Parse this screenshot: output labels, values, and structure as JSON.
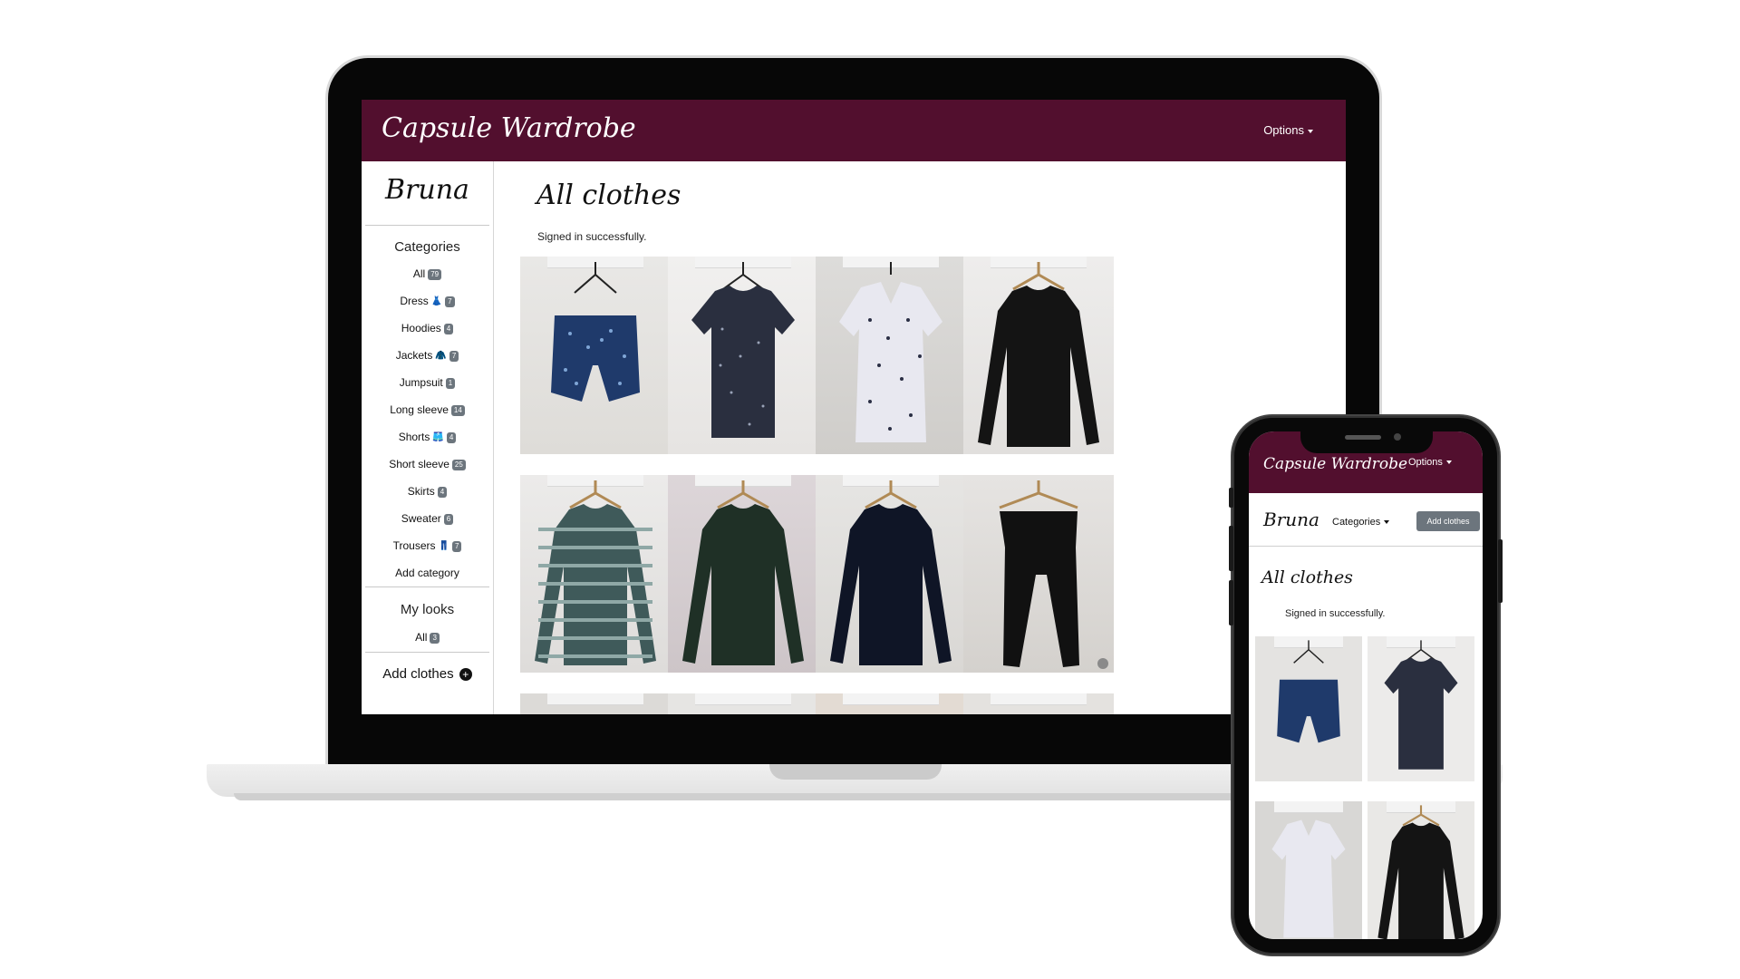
{
  "app": {
    "brand": "Capsule Wardrobe",
    "options_label": "Options"
  },
  "user": {
    "name": "Bruna"
  },
  "sidebar": {
    "categories_heading": "Categories",
    "categories": [
      {
        "label": "All",
        "count": "79",
        "icon": ""
      },
      {
        "label": "Dress",
        "count": "7",
        "icon": "dress-icon"
      },
      {
        "label": "Hoodies",
        "count": "4",
        "icon": ""
      },
      {
        "label": "Jackets",
        "count": "7",
        "icon": "jacket-icon"
      },
      {
        "label": "Jumpsuit",
        "count": "1",
        "icon": ""
      },
      {
        "label": "Long sleeve",
        "count": "14",
        "icon": ""
      },
      {
        "label": "Shorts",
        "count": "4",
        "icon": "shorts-icon"
      },
      {
        "label": "Short sleeve",
        "count": "25",
        "icon": ""
      },
      {
        "label": "Skirts",
        "count": "4",
        "icon": ""
      },
      {
        "label": "Sweater",
        "count": "6",
        "icon": ""
      },
      {
        "label": "Trousers",
        "count": "7",
        "icon": "trousers-icon"
      }
    ],
    "add_category_label": "Add category",
    "looks_heading": "My looks",
    "looks": [
      {
        "label": "All",
        "count": "3"
      }
    ],
    "add_clothes_label": "Add clothes"
  },
  "main": {
    "title": "All clothes",
    "flash": "Signed in successfully."
  },
  "mobile": {
    "categories_label": "Categories",
    "add_clothes_button": "Add clothes"
  },
  "colors": {
    "navbar": "#520f2e",
    "badge": "#6c757d",
    "button": "#6c757d"
  }
}
